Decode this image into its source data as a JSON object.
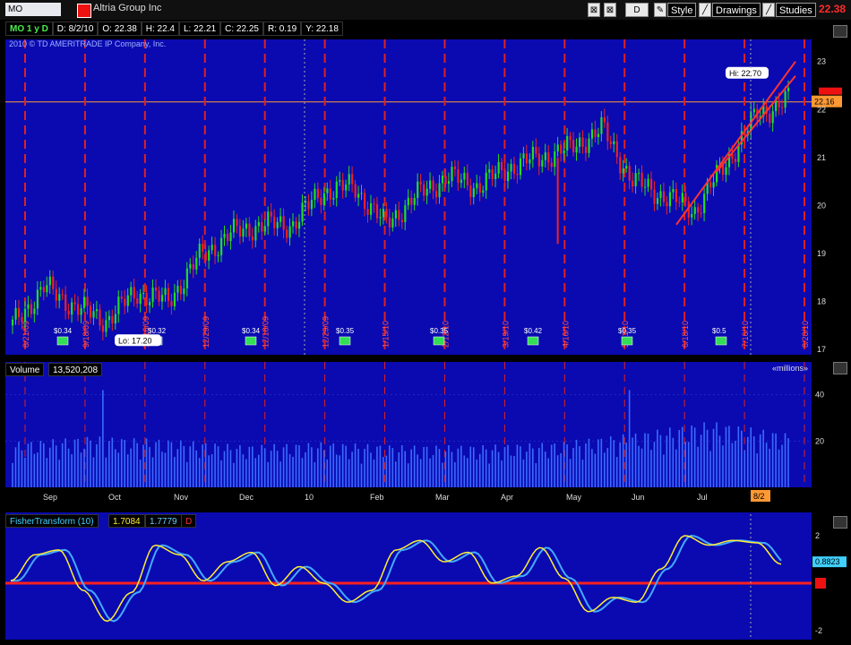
{
  "toolbar": {
    "symbol": "MO",
    "company": "Altria Group Inc",
    "period_button": "D",
    "style_label": "Style",
    "drawings_label": "Drawings",
    "studies_label": "Studies",
    "last_price": "22.38"
  },
  "info_bar": {
    "symbol_period": "MO 1 y D",
    "date": "D: 8/2/10",
    "open": "O: 22.38",
    "high": "H: 22.4",
    "low": "L: 22.21",
    "close": "C: 22.25",
    "range": "R: 0.19",
    "y": "Y: 22.18"
  },
  "copyright": "2010 © TD AMERITRADE IP Company, Inc.",
  "price_panel": {
    "hi_label": "Hi: 22.70",
    "lo_label": "Lo: 17.20",
    "current_price_label": "22.16",
    "y_ticks": [
      "23",
      "22",
      "21",
      "20",
      "19",
      "18",
      "17"
    ],
    "event_labels": [
      {
        "date": "8/21/09",
        "kind": "earnings"
      },
      {
        "date": "9/18/09",
        "kind": "earnings"
      },
      {
        "date": "10/16/09",
        "kind": "earnings"
      },
      {
        "date": "12/29/09",
        "kind": "dividend"
      },
      {
        "date": "12/18/09",
        "kind": "earnings"
      },
      {
        "date": "12/29/09",
        "kind": "split"
      },
      {
        "date": "1/15/10",
        "kind": "earnings"
      },
      {
        "date": "2/12/10",
        "kind": "earnings"
      },
      {
        "date": "3/19/10",
        "kind": "earnings"
      },
      {
        "date": "4/16/10",
        "kind": "earnings"
      },
      {
        "date": "5/21/10",
        "kind": "earnings"
      },
      {
        "date": "6/18/10",
        "kind": "earnings"
      },
      {
        "date": "7/16/10",
        "kind": "earnings"
      },
      {
        "date": "8/20/10",
        "kind": "earnings"
      }
    ],
    "dividend_labels": [
      "$0.34",
      "$0.32",
      "$0.34",
      "$0.35",
      "$0.35",
      "$0.42",
      "$0.35",
      "$0.5"
    ]
  },
  "volume_panel": {
    "label": "Volume",
    "value": "13,520,208",
    "units": "«millions»",
    "y_ticks": [
      "40",
      "20"
    ]
  },
  "x_axis": {
    "months": [
      "Sep",
      "Oct",
      "Nov",
      "Dec",
      "10",
      "Feb",
      "Mar",
      "Apr",
      "May",
      "Jun",
      "Jul"
    ],
    "current_marker": "8/2"
  },
  "fisher_panel": {
    "label": "FisherTransform (10)",
    "value1": "1.7084",
    "value2": "1.7779",
    "flag": "D",
    "y_ticks": [
      "2",
      "-2"
    ],
    "current_value_label": "0.8823"
  },
  "colors": {
    "background": "#0a0ab0",
    "grid_red": "#e02020",
    "up_candle": "#22dd22",
    "down_candle": "#ee2222",
    "volume_bar": "#3a6bff",
    "fisher_line": "#ffee33",
    "trigger_line": "#44aaff",
    "zero_line": "#ff2020"
  },
  "chart_data": [
    {
      "type": "candlestick",
      "title": "MO 1 y D",
      "x": [
        "2009-08-21",
        "2009-09-04",
        "2009-09-18",
        "2009-10-02",
        "2009-10-16",
        "2009-10-30",
        "2009-11-13",
        "2009-11-27",
        "2009-12-11",
        "2009-12-24",
        "2010-01-08",
        "2010-01-22",
        "2010-02-05",
        "2010-02-19",
        "2010-03-05",
        "2010-03-19",
        "2010-04-02",
        "2010-04-16",
        "2010-04-30",
        "2010-05-14",
        "2010-05-28",
        "2010-06-11",
        "2010-06-25",
        "2010-07-09",
        "2010-07-23",
        "2010-08-02"
      ],
      "close": [
        17.5,
        18.3,
        17.9,
        17.6,
        18.2,
        18.0,
        18.9,
        19.4,
        19.6,
        19.6,
        20.3,
        20.4,
        19.6,
        20.2,
        20.6,
        20.4,
        20.8,
        21.0,
        21.2,
        21.6,
        20.5,
        20.2,
        19.9,
        20.9,
        21.9,
        22.2
      ],
      "ylim": [
        17,
        23.2
      ],
      "hi": 22.7,
      "lo": 17.2
    },
    {
      "type": "bar",
      "title": "Volume",
      "ylabel": "millions",
      "x": [
        "Sep",
        "Oct",
        "Nov",
        "Dec",
        "10",
        "Feb",
        "Mar",
        "Apr",
        "May",
        "Jun",
        "Jul"
      ],
      "values": [
        15,
        17,
        16,
        14,
        15,
        14,
        14,
        15,
        18,
        22,
        18
      ],
      "ylim": [
        0,
        48
      ]
    },
    {
      "type": "line",
      "title": "FisherTransform (10)",
      "series": [
        {
          "name": "",
          "values": [
            0.1,
            1.2,
            1.4,
            -0.3,
            -1.6,
            -0.4,
            1.6,
            1.2,
            0.1,
            0.9,
            1.3,
            -0.1,
            0.7,
            0.0,
            -0.8,
            -0.3,
            1.4,
            1.8,
            0.9,
            1.3,
            0.0,
            0.3,
            1.5,
            0.2,
            -1.2,
            -0.6,
            -0.8,
            0.6,
            2.0,
            1.6,
            1.8,
            1.7,
            0.8
          ]
        }
      ],
      "ylim": [
        -2.3,
        2.3
      ]
    }
  ]
}
